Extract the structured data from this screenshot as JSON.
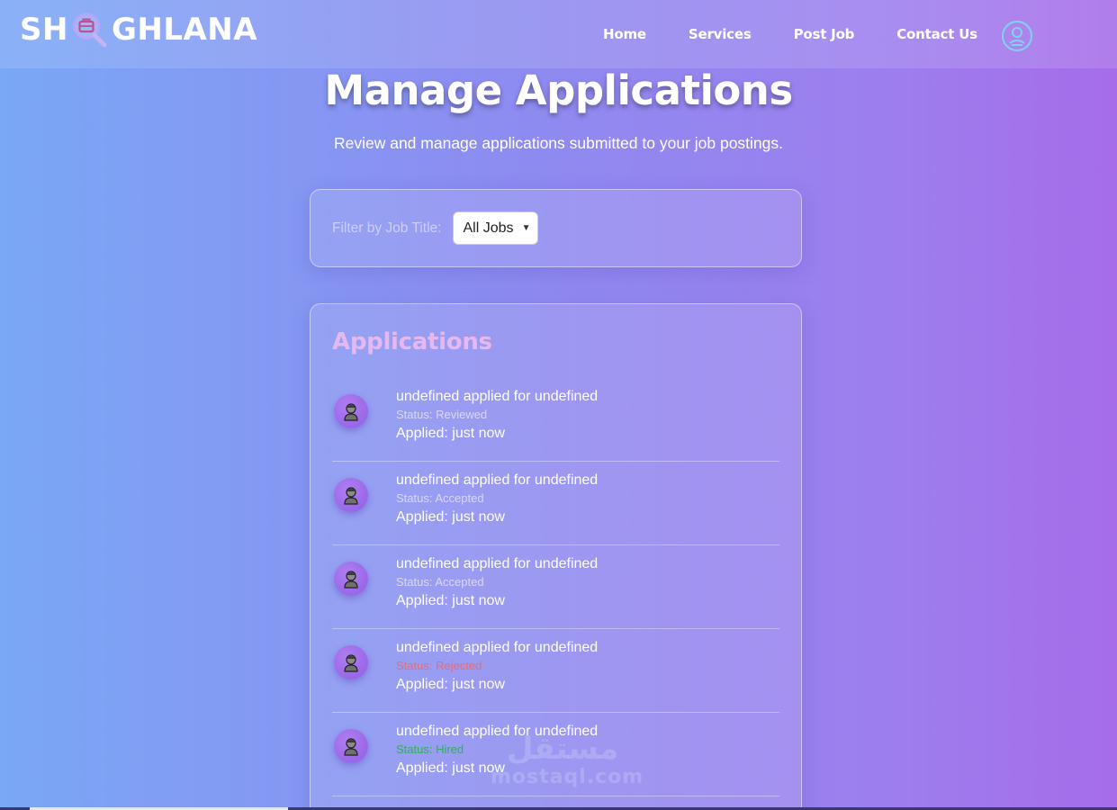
{
  "brand": {
    "logo_left": "SH",
    "logo_right": "GHLANA"
  },
  "nav": {
    "items": [
      {
        "label": "Home"
      },
      {
        "label": "Services"
      },
      {
        "label": "Post Job"
      },
      {
        "label": "Contact Us"
      }
    ]
  },
  "header": {
    "title": "Manage Applications",
    "subtitle": "Review and manage applications submitted to your job postings."
  },
  "filter": {
    "label": "Filter by Job Title:",
    "selected": "All Jobs"
  },
  "applications": {
    "title": "Applications",
    "items": [
      {
        "name": "undefined applied for undefined",
        "status": "Status: Reviewed",
        "status_color": "#dcd6f5",
        "date": "Applied: just now"
      },
      {
        "name": "undefined applied for undefined",
        "status": "Status: Accepted",
        "status_color": "#dcd6f5",
        "date": "Applied: just now"
      },
      {
        "name": "undefined applied for undefined",
        "status": "Status: Accepted",
        "status_color": "#dcd6f5",
        "date": "Applied: just now"
      },
      {
        "name": "undefined applied for undefined",
        "status": "Status: Rejected",
        "status_color": "#f06a6a",
        "date": "Applied: just now"
      },
      {
        "name": "undefined applied for undefined",
        "status": "Status: Hired",
        "status_color": "#2fae5c",
        "date": "Applied: just now"
      }
    ]
  },
  "watermark": {
    "arabic": "مستقل",
    "latin": "mostaql.com"
  },
  "colors": {
    "accent": "#e7b8f0",
    "avatar": "#9a66ea",
    "status_rejected": "#f06a6a",
    "status_hired": "#2fae5c"
  }
}
